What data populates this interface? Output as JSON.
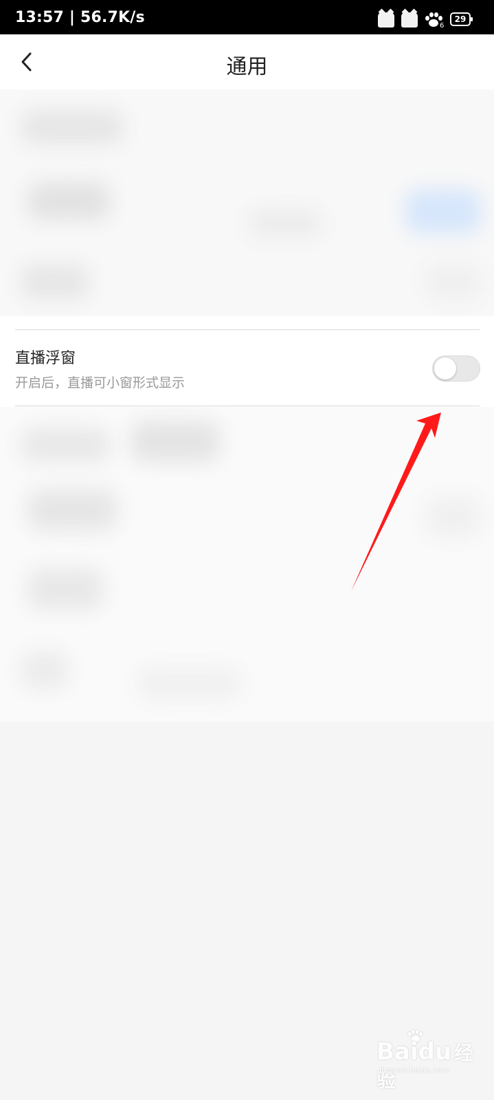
{
  "status_bar": {
    "time_speed": "13:57 | 56.7K/s",
    "paw_count": "6",
    "battery": "29"
  },
  "header": {
    "title": "通用"
  },
  "setting": {
    "title": "直播浮窗",
    "subtitle": "开启后，直播可小窗形式显示",
    "toggle_on": false
  },
  "watermark": {
    "brand": "Baidu",
    "brand_cn": "经验",
    "url": "jingyan.baidu.com"
  },
  "colors": {
    "arrow": "#ff1a1a",
    "toggle_off": "#e8e8e8"
  }
}
